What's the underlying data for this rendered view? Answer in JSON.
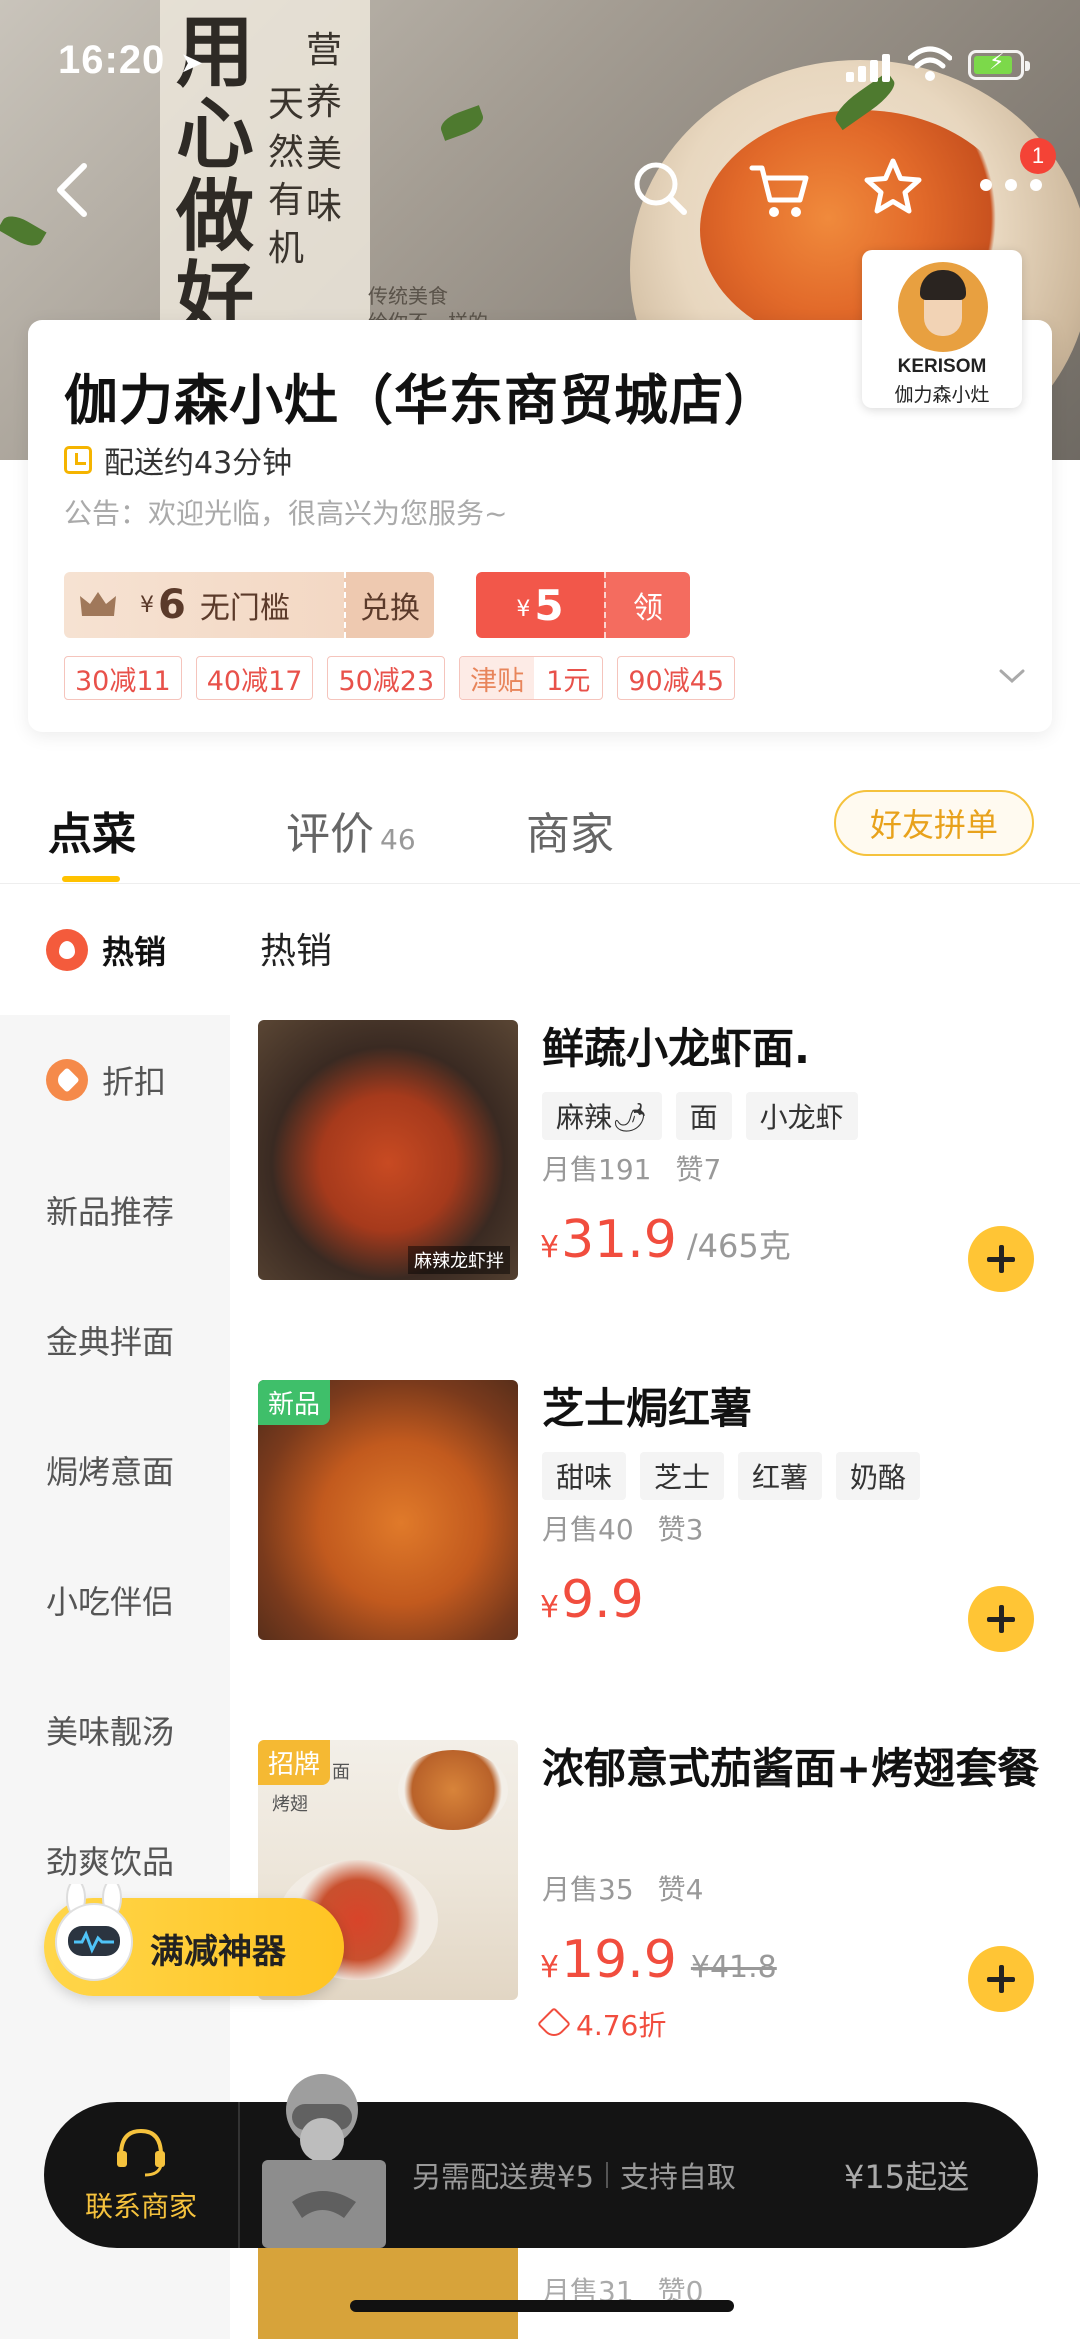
{
  "status_bar": {
    "time": "16:20"
  },
  "banner": {
    "title_chars": [
      "用",
      "心",
      "做",
      "好"
    ],
    "col1": [
      "营",
      "养",
      "美",
      "味"
    ],
    "col2": [
      "天",
      "然",
      "有",
      "机"
    ],
    "caption_1": "传统美食",
    "caption_2": "给你不一样的",
    "more_badge": "1"
  },
  "shop": {
    "name": "伽力森小灶（华东商贸城店）",
    "delivery": "配送约43分钟",
    "notice": "公告：欢迎光临，很高兴为您服务~",
    "logo_brand": "KERISOM",
    "logo_brand_cn": "伽力森小灶",
    "member_coupon": {
      "currency": "¥",
      "amount": "6",
      "desc": "无门槛",
      "action": "兑换"
    },
    "red_coupon": {
      "currency": "¥",
      "amount": "5",
      "action": "领"
    },
    "promotions": [
      "30减11",
      "40减17",
      "50减23",
      "90减45"
    ],
    "subsidy": {
      "tag": "津贴",
      "value": "1元"
    }
  },
  "tabs": [
    {
      "label": "点菜",
      "count": ""
    },
    {
      "label": "评价",
      "count": "46"
    },
    {
      "label": "商家",
      "count": ""
    }
  ],
  "group_order_label": "好友拼单",
  "sidebar": {
    "items": [
      {
        "label": "热销"
      },
      {
        "label": "折扣"
      },
      {
        "label": "新品推荐"
      },
      {
        "label": "金典拌面"
      },
      {
        "label": "焗烤意面"
      },
      {
        "label": "小吃伴侣"
      },
      {
        "label": "美味靓汤"
      },
      {
        "label": "劲爽饮品"
      }
    ]
  },
  "section_title": "热销",
  "dishes": [
    {
      "name": "鲜蔬小龙虾面.",
      "tags": [
        "麻辣🌶",
        "面",
        "小龙虾"
      ],
      "monthly_sales": "月售191",
      "likes": "赞7",
      "currency": "¥",
      "price": "31.9",
      "unit": "/465克",
      "image_caption": "麻辣龙虾拌"
    },
    {
      "badge": "新品",
      "name": "芝士焗红薯",
      "tags": [
        "甜味",
        "芝士",
        "红薯",
        "奶酪"
      ],
      "monthly_sales": "月售40",
      "likes": "赞3",
      "currency": "¥",
      "price": "9.9"
    },
    {
      "badge": "招牌",
      "name": "浓郁意式茄酱面+烤翅套餐",
      "monthly_sales": "月售35",
      "likes": "赞4",
      "currency": "¥",
      "price": "19.9",
      "original_price": "¥41.8",
      "discount": "4.76折",
      "image_label_1": "面",
      "image_label_2": "烤翅"
    }
  ],
  "next_dish_peek": {
    "monthly_sales": "月售31",
    "likes": "赞0"
  },
  "helper": {
    "label": "满减神器"
  },
  "bottom_bar": {
    "contact_label": "联系商家",
    "delivery_fee": "另需配送费¥5",
    "pickup": "支持自取",
    "min_order": "¥15起送"
  },
  "colors": {
    "accent": "#ffc200",
    "price_red": "#f14d3e",
    "new_badge": "#3fbf6a",
    "bar_bg": "#141414"
  }
}
